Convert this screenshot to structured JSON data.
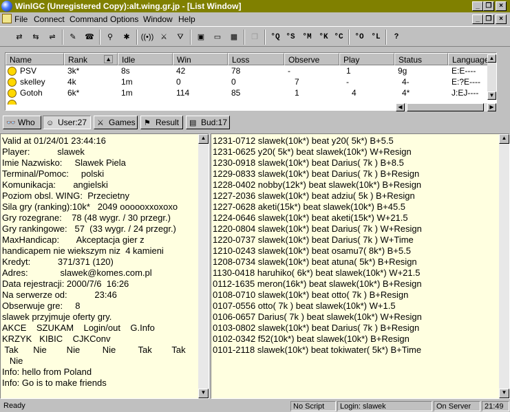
{
  "window": {
    "title": "WinIGC (Unregistered Copy):alt.wing.gr.jp - [List Window]"
  },
  "menu": [
    "File",
    "Connect",
    "Command",
    "Options",
    "Window",
    "Help"
  ],
  "toolbar": {
    "label_buttons": [
      "°Q",
      "°S",
      "°M",
      "°K",
      "°C",
      "°O",
      "°L",
      "?"
    ]
  },
  "players_table": {
    "columns": [
      "Name",
      "Rank",
      "Idle",
      "Win",
      "Loss",
      "Observe",
      "Play",
      "Status",
      "Language"
    ],
    "rows": [
      {
        "name": "PSV",
        "rank": "3k*",
        "idle": "8s",
        "win": "42",
        "loss": "78",
        "observe": "-",
        "play": "1",
        "status": "9g",
        "language": "E:E----"
      },
      {
        "name": "skelley",
        "rank": "4k",
        "idle": "1m",
        "win": "0",
        "loss": "0",
        "observe": "7",
        "play": "-",
        "status": "4-",
        "language": "E:?E----"
      },
      {
        "name": "Gotoh",
        "rank": "6k*",
        "idle": "1m",
        "win": "114",
        "loss": "85",
        "observe": "1",
        "play": "4",
        "status": "4*",
        "language": "J:EJ----"
      }
    ]
  },
  "tabs": [
    {
      "label": "Who",
      "icon": "binoculars-icon"
    },
    {
      "label": "User:27",
      "icon": "user-icon"
    },
    {
      "label": "Games",
      "icon": "games-icon"
    },
    {
      "label": "Result",
      "icon": "flag-icon"
    },
    {
      "label": "Bud:17",
      "icon": "book-icon"
    }
  ],
  "user_info": [
    "Valid at 01/24/01 23:44:16",
    "Player:           slawek",
    "Imie Nazwisko:     Slawek Piela",
    "Terminal/Pomoc:     polski",
    "Komunikacja:       angielski",
    "Poziom obsl. WING:  Przecietny",
    "Sila gry (ranking):10k*   2049 oooooxxoxoxo",
    "Gry rozegrane:    78 (48 wygr. / 30 przegr.)",
    "Gry rankingowe:   57  (33 wygr. / 24 przegr.)",
    "MaxHandicap:       Akceptacja gier z",
    "handicapem nie wiekszym niz  4 kamieni",
    "Kredyt:           371/371 (120)",
    "Adres:             slawek@komes.com.pl",
    "Data rejestracji: 2000/7/6  16:26",
    "Na serwerze od:           23:46",
    "Obserwuje gre:     8",
    "slawek przyjmuje oferty gry.",
    "AKCE    SZUKAM    Login/out    G.Info",
    "KRZYK   KIBIC    CJKConv",
    " Tak      Nie        Nie         Nie         Tak        Tak",
    "   Nie",
    "Info: hello from Poland",
    "Info: Go is to make friends"
  ],
  "game_results": [
    "1231-0712 slawek(10k*) beat y20( 5k*) B+5.5",
    "1231-0625 y20( 5k*) beat slawek(10k*) W+Resign",
    "1230-0918 slawek(10k*) beat Darius( 7k ) B+8.5",
    "1229-0833 slawek(10k*) beat Darius( 7k ) B+Resign",
    "1228-0402 nobby(12k*) beat slawek(10k*) B+Resign",
    "1227-2036 slawek(10k*) beat adziu( 5k ) B+Resign",
    "1227-0628 aketi(15k*) beat slawek(10k*) B+45.5",
    "1224-0646 slawek(10k*) beat aketi(15k*) W+21.5",
    "1220-0804 slawek(10k*) beat Darius( 7k ) W+Resign",
    "1220-0737 slawek(10k*) beat Darius( 7k ) W+Time",
    "1210-0243 slawek(10k*) beat osamu7( 8k*) B+5.5",
    "1208-0734 slawek(10k*) beat atuna( 5k*) B+Resign",
    "1130-0418 haruhiko( 6k*) beat slawek(10k*) W+21.5",
    "0112-1635 meron(16k*) beat slawek(10k*) B+Resign",
    "0108-0710 slawek(10k*) beat otto( 7k ) B+Resign",
    "0107-0556 otto( 7k ) beat slawek(10k*) W+1.5",
    "0106-0657 Darius( 7k ) beat slawek(10k*) W+Resign",
    "0103-0802 slawek(10k*) beat Darius( 7k ) B+Resign",
    "0102-0342 f52(10k*) beat slawek(10k*) B+Resign",
    "0101-2118 slawek(10k*) beat tokiwater( 5k*) B+Time"
  ],
  "status": {
    "ready": "Ready",
    "script": "No Script",
    "login": "Login: slawek",
    "server": "On Server",
    "time": "21:49"
  },
  "colors": {
    "titlebar": "#808000",
    "pane_bg": "#ffffe0",
    "face": "#c0c0c0"
  }
}
